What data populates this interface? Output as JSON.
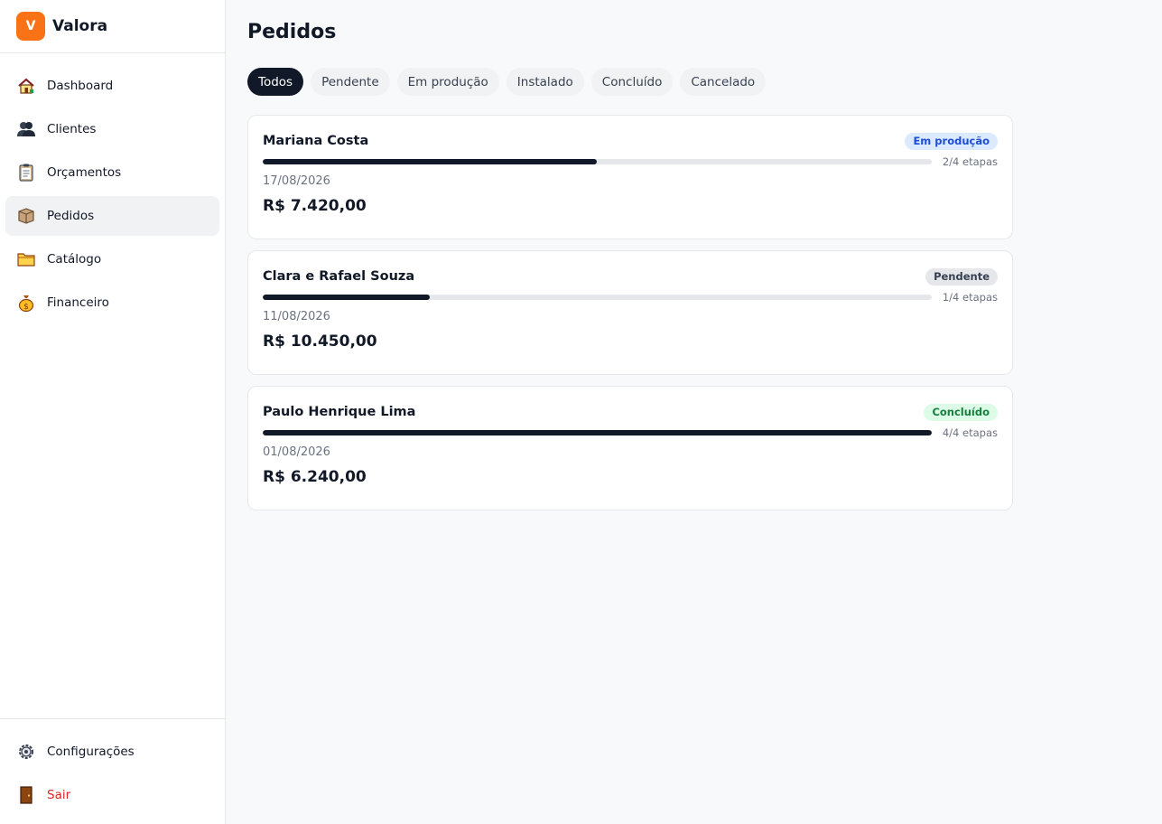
{
  "brand": {
    "logo_letter": "V",
    "name": "Valora",
    "color": "#f97316"
  },
  "sidebar": {
    "items": [
      {
        "label": "Dashboard",
        "icon": "house-icon"
      },
      {
        "label": "Clientes",
        "icon": "users-icon"
      },
      {
        "label": "Orçamentos",
        "icon": "clipboard-icon"
      },
      {
        "label": "Pedidos",
        "icon": "package-icon",
        "active": true
      },
      {
        "label": "Catálogo",
        "icon": "folder-icon"
      },
      {
        "label": "Financeiro",
        "icon": "money-bag-icon"
      }
    ],
    "bottom": [
      {
        "label": "Configurações",
        "icon": "gear-icon"
      },
      {
        "label": "Sair",
        "icon": "door-icon"
      }
    ]
  },
  "main": {
    "title": "Pedidos",
    "tabs": [
      {
        "label": "Todos",
        "active": true
      },
      {
        "label": "Pendente"
      },
      {
        "label": "Em produção"
      },
      {
        "label": "Instalado"
      },
      {
        "label": "Concluído"
      },
      {
        "label": "Cancelado"
      }
    ],
    "orders": [
      {
        "client": "Mariana Costa",
        "status": "Em produção",
        "progress": 0.5,
        "steps": "2/4 etapas",
        "date": "17/08/2026",
        "value": "R$ 7.420,00"
      },
      {
        "client": "Clara e Rafael Souza",
        "status": "Pendente",
        "progress": 0.25,
        "steps": "1/4 etapas",
        "date": "11/08/2026",
        "value": "R$ 10.450,00"
      },
      {
        "client": "Paulo Henrique Lima",
        "status": "Concluído",
        "progress": 1.0,
        "steps": "4/4 etapas",
        "date": "01/08/2026",
        "value": "R$ 6.240,00"
      }
    ]
  }
}
